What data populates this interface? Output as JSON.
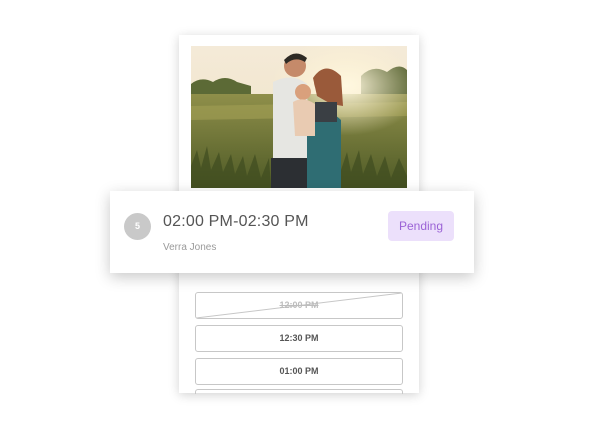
{
  "appointment": {
    "index": "5",
    "time_range": "02:00 PM-02:30 PM",
    "client_name": "Verra Jones",
    "status": "Pending",
    "status_color": "#9b63d6",
    "status_bg": "#ece0fb"
  },
  "photo": {
    "icon": "family-photo"
  },
  "time_slots": [
    {
      "label": "12:00 PM",
      "available": false
    },
    {
      "label": "12:30 PM",
      "available": true
    },
    {
      "label": "01:00 PM",
      "available": true
    }
  ]
}
